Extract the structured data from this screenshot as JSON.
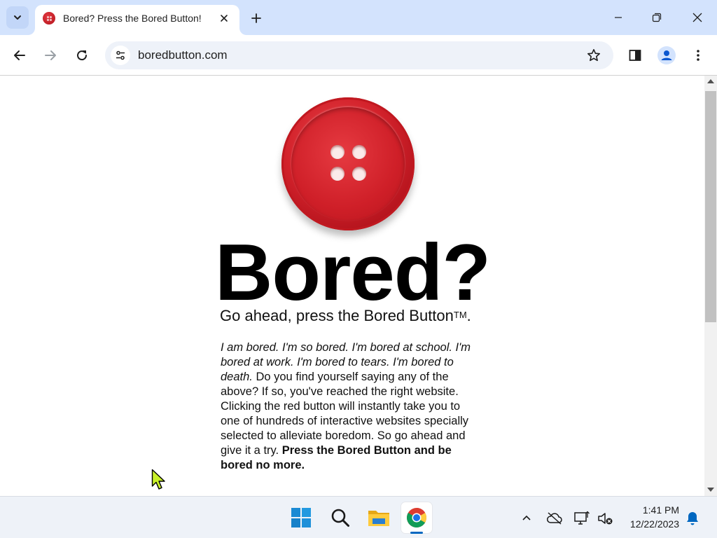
{
  "browser": {
    "tab": {
      "title": "Bored? Press the Bored Button!"
    },
    "url": "boredbutton.com"
  },
  "page": {
    "headline": "Bored?",
    "tagline": "Go ahead, press the Bored Button",
    "trademark": "TM",
    "tagline_end": ".",
    "description": {
      "italic": "I am bored. I'm so bored. I'm bored at school. I'm bored at work. I'm bored to tears. I'm bored to death.",
      "body": " Do you find yourself saying any of the above? If so, you've reached the right website. Clicking the red button will instantly take you to one of hundreds of interactive websites specially selected to alleviate boredom. So go ahead and give it a try. ",
      "bold": "Press the Bored Button and be bored no more."
    }
  },
  "taskbar": {
    "apps": [
      "windows-start",
      "search",
      "file-explorer",
      "chrome"
    ],
    "clock": {
      "time": "1:41 PM",
      "date": "12/22/2023"
    }
  },
  "colors": {
    "titlebar": "#d3e3fd",
    "button_red": "#d3222b",
    "taskbar": "#eef2f8",
    "accent": "#0067c0"
  }
}
